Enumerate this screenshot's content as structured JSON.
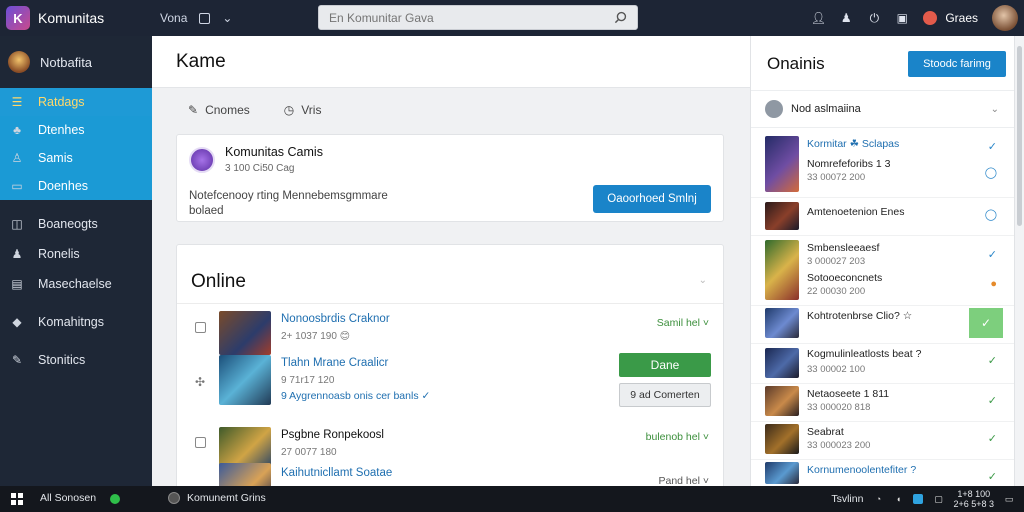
{
  "topbar": {
    "app_name": "Komunitas",
    "nav_label": "Vona",
    "search_placeholder": "En Komunitar Gava"
  },
  "user": {
    "name": "Graes"
  },
  "sidebar": {
    "profile_label": "Notbafita",
    "items": [
      {
        "label": "Ratdags",
        "icon": "list-icon"
      },
      {
        "label": "Dtenhes",
        "icon": "group-icon"
      },
      {
        "label": "Samis",
        "icon": "user-icon"
      },
      {
        "label": "Doenhes",
        "icon": "contact-card-icon"
      },
      {
        "label": "Boaneogts",
        "icon": "board-icon"
      },
      {
        "label": "Ronelis",
        "icon": "person-icon"
      },
      {
        "label": "Masechaelse",
        "icon": "media-icon"
      },
      {
        "label": "Komahitngs",
        "icon": "tag-icon"
      },
      {
        "label": "Stonitics",
        "icon": "wrench-icon"
      }
    ]
  },
  "main": {
    "title": "Kame",
    "tabs": [
      {
        "label": "Cnomes"
      },
      {
        "label": "Vris"
      }
    ],
    "group": {
      "name": "Komunitas Camis",
      "sub": "3 100 Ci50 Cag",
      "description": "Notefcenooy rting Mennebemsgmmare bolaed",
      "button": "Oaoorhoed Smlnj"
    },
    "online": {
      "title": "Online",
      "rows": [
        {
          "title": "Nonoosbrdis Craknor",
          "sub": "2+ 1037 190 😊",
          "status": "Samil hel ˅"
        },
        {
          "title": "Tlahn Mrane Craalicr",
          "sub": "9 71r17 120",
          "note": "9 Aygrennoasb onis cer banls ✓",
          "button_primary": "Dane",
          "button_secondary": "9 ad Comerten"
        },
        {
          "title": "Psgbne Ronpekoosl",
          "sub": "27 0077 180",
          "status": "bulenob hel ˅"
        },
        {
          "title": "Kaihutnicllamt Soatae",
          "status": "Pand hel ˅"
        }
      ]
    }
  },
  "right": {
    "title": "Onainis",
    "button": "Stoodc farimg",
    "sort_label": "Nod aslmaiina",
    "items": [
      {
        "title": "Kormitar ☘ Sclapas",
        "sub": "",
        "check": "✓"
      },
      {
        "title": "Nomrefeforibs 1 3",
        "sub": "33 00072 200",
        "check": "◯"
      },
      {
        "title": "Amtenoetenion Enes",
        "sub": "",
        "check": "◯"
      },
      {
        "title": "Smbensleeaesf",
        "sub": "3 000027 203",
        "check": "✓"
      },
      {
        "title": "Sotooeconcnets",
        "sub": "22 00030 200",
        "check": "●"
      },
      {
        "title": "Kohtrotenbrse Clio? ☆",
        "sub": "",
        "check": "✓"
      },
      {
        "title": "Kogmulinleatlosts beat ?",
        "sub": "33 00002 100",
        "check": "✓"
      },
      {
        "title": "Netaoseete 1 811",
        "sub": "33 000020 818",
        "check": "✓"
      },
      {
        "title": "Seabrat",
        "sub": "33 000023 200",
        "check": "✓"
      },
      {
        "title": "Kornumenoolentefiter ?",
        "sub": "",
        "check": "✓"
      }
    ]
  },
  "taskbar": {
    "search_label": "All Sonosen",
    "app_label": "Komunemt Grins",
    "status": "Tsvlinn",
    "clock_time": "1+8 100",
    "clock_date": "2+6 5+8 3"
  },
  "colors": {
    "topbar_bg": "#1d2535",
    "sidebar_bg": "#1e2736",
    "sidebar_active": "#1e9ad6",
    "primary": "#1a84c9",
    "success": "#3a9a48"
  }
}
